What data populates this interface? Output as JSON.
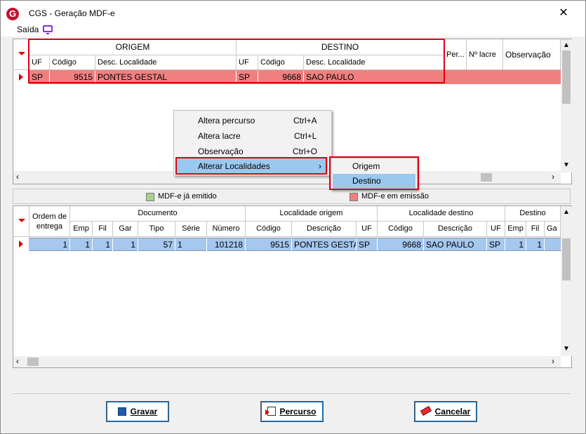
{
  "window": {
    "title": "CGS - Geração MDF-e",
    "close_glyph": "✕",
    "logo_letter": "G"
  },
  "menu": {
    "saida": "Saída"
  },
  "top_grid": {
    "group_origem": "ORIGEM",
    "group_destino": "DESTINO",
    "col_uf": "UF",
    "col_codigo": "Código",
    "col_desc": "Desc. Localidade",
    "col_per": "Per...",
    "col_lacre": "Nº lacre",
    "col_obs": "Observação",
    "row": {
      "orig_uf": "SP",
      "orig_cod": "9515",
      "orig_desc": "PONTES GESTAL",
      "dest_uf": "SP",
      "dest_cod": "9668",
      "dest_desc": "SAO PAULO"
    }
  },
  "context_menu": {
    "items": [
      {
        "label": "Altera percurso",
        "shortcut": "Ctrl+A"
      },
      {
        "label": "Altera lacre",
        "shortcut": "Ctrl+L"
      },
      {
        "label": "Observação",
        "shortcut": "Ctrl+O"
      },
      {
        "label": "Alterar Localidades",
        "shortcut": "›"
      }
    ],
    "submenu": [
      "Origem",
      "Destino"
    ]
  },
  "legend": {
    "emitido": "MDF-e já emitido",
    "emissao": "MDF-e em emissão",
    "emitido_color": "#a9d18e",
    "emissao_color": "#f08080"
  },
  "bottom_grid": {
    "h_ordem": "Ordem de entrega",
    "h_documento": "Documento",
    "h_loc_origem": "Localidade origem",
    "h_loc_destino": "Localidade destino",
    "h_destino": "Destino",
    "sub": {
      "emp": "Emp",
      "fil": "Fil",
      "gar": "Gar",
      "tipo": "Tipo",
      "serie": "Série",
      "numero": "Número",
      "codigo": "Código",
      "descricao": "Descrição",
      "uf": "UF",
      "ga": "Ga"
    },
    "row": {
      "ordem": "1",
      "emp": "1",
      "fil": "1",
      "gar": "1",
      "tipo": "57",
      "serie": "1",
      "numero": "101218",
      "o_cod": "9515",
      "o_desc": "PONTES GESTAL",
      "o_uf": "SP",
      "d_cod": "9668",
      "d_desc": "SAO PAULO",
      "d_uf": "SP",
      "d_emp": "1",
      "d_fil": "1"
    }
  },
  "buttons": {
    "gravar": "Gravar",
    "percurso": "Percurso",
    "cancelar": "Cancelar"
  }
}
